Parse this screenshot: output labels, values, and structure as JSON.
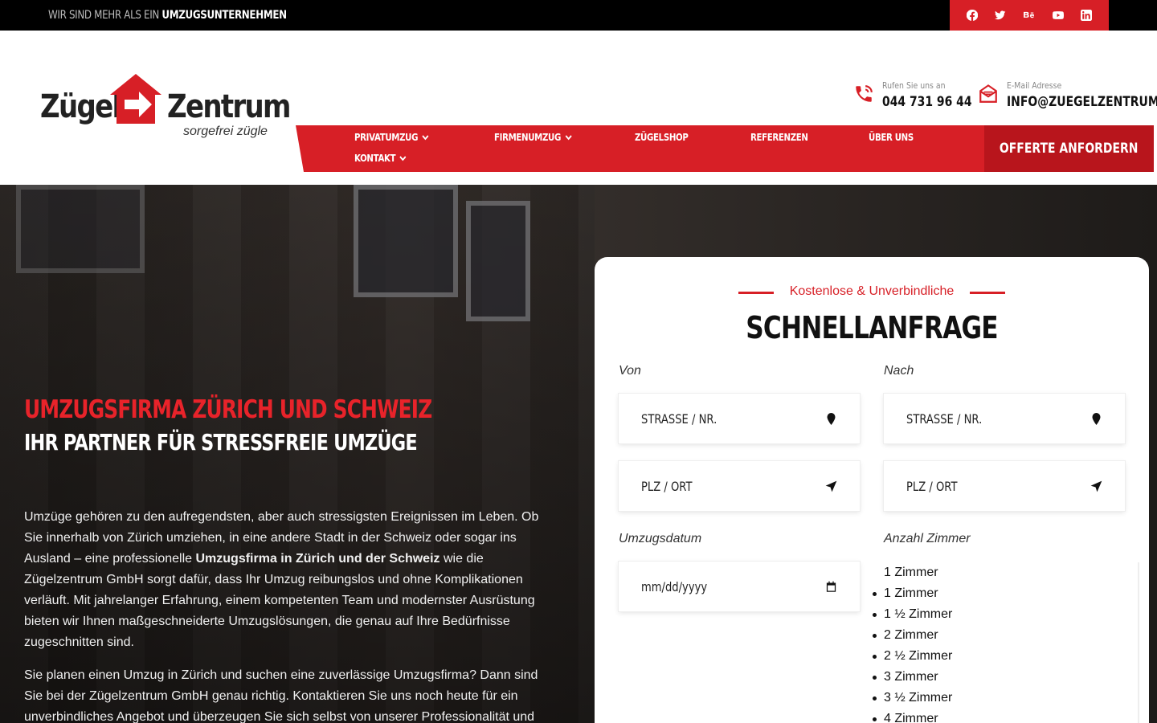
{
  "topbar": {
    "tagline_prefix": "Wir sind mehr als ein",
    "tagline_bold": "Umzugsunternehmen",
    "socials": [
      "facebook-icon",
      "twitter-icon",
      "behance-icon",
      "youtube-icon",
      "linkedin-icon"
    ]
  },
  "logo": {
    "word1": "Zügel",
    "word2": "Zentrum",
    "slogan": "sorgefrei zügle"
  },
  "contact": {
    "phone_label": "Rufen Sie uns an",
    "phone_value": "044 731 96 44",
    "email_label": "E-Mail Adresse",
    "email_value": "INFO@ZUEGELZENTRUM.CH"
  },
  "nav": {
    "items": [
      {
        "label": "Privatumzug"
      },
      {
        "label": "Firmenumzug"
      },
      {
        "label": "Zügelshop"
      },
      {
        "label": "Referenzen"
      },
      {
        "label": "Über uns"
      },
      {
        "label": "Kontakt"
      }
    ],
    "cta": "Offerte anfordern"
  },
  "hero": {
    "title": "Umzugsfirma Zürich und Schweiz",
    "subtitle": "Ihr Partner für stressfreie Umzüge",
    "p1_a": "Umzüge gehören zu den aufregendsten, aber auch stressigsten Ereignissen im Leben. Ob Sie innerhalb von Zürich umziehen, in eine andere Stadt in der Schweiz oder sogar ins Ausland – eine professionelle ",
    "p1_bold": "Umzugsfirma in Zürich und der Schweiz",
    "p1_b": " wie die Zügelzentrum GmbH sorgt dafür, dass Ihr Umzug reibungslos und ohne Komplikationen verläuft. Mit jahrelanger Erfahrung, einem kompetenten Team und modernster Ausrüstung bieten wir Ihnen maßgeschneiderte Umzugslösungen, die genau auf Ihre Bedürfnisse zugeschnitten sind.",
    "p2": "Sie planen einen Umzug in Zürich und suchen eine zuverlässige Umzugsfirma? Dann sind Sie bei der Zügelzentrum GmbH genau richtig. Kontaktieren Sie uns noch heute für ein unverbindliches Angebot und überzeugen Sie sich selbst von unserer Professionalität und"
  },
  "form": {
    "kicker": "Kostenlose & Unverbindliche",
    "title": "Schnellanfrage",
    "von_label": "Von",
    "nach_label": "Nach",
    "street_placeholder": "Strasse / Nr.",
    "plz_placeholder": "PLZ / Ort",
    "date_label": "Umzugsdatum",
    "date_placeholder": "mm/dd/yyyy",
    "rooms_label": "Anzahl Zimmer",
    "rooms_selected": "1 Zimmer",
    "rooms_options": [
      "1 Zimmer",
      "1 ½ Zimmer",
      "2 Zimmer",
      "2 ½ Zimmer",
      "3 Zimmer",
      "3 ½ Zimmer",
      "4 Zimmer"
    ]
  }
}
